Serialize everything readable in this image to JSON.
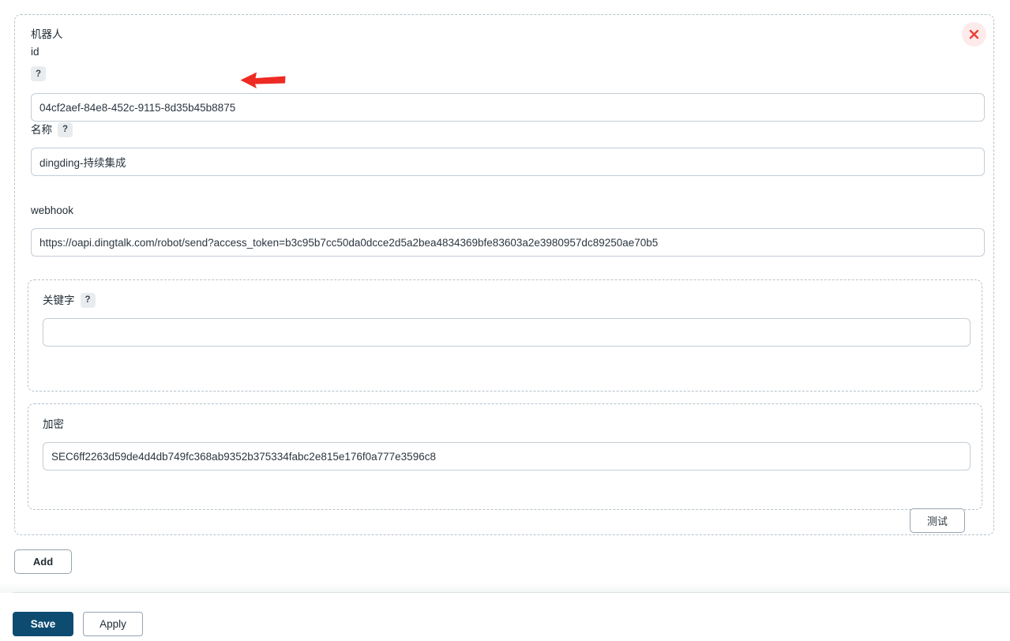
{
  "card": {
    "close_icon": "close-icon",
    "test_button_label": "测试",
    "add_button_label": "Add"
  },
  "fields": {
    "robot_id": {
      "label": "机器人\nid",
      "help": "?",
      "value": "04cf2aef-84e8-452c-9115-8d35b45b8875",
      "placeholder": ""
    },
    "name": {
      "label": "名称",
      "help": "?",
      "value": "dingding-持续集成",
      "placeholder": ""
    },
    "webhook": {
      "label": "webhook",
      "value": "https://oapi.dingtalk.com/robot/send?access_token=b3c95b7cc50da0dcce2d5a2bea4834369bfe83603a2e3980957dc89250ae70b5",
      "placeholder": ""
    },
    "keyword": {
      "label": "关键字",
      "help": "?",
      "value": "",
      "placeholder": ""
    },
    "encrypt": {
      "label": "加密",
      "value": "SEC6ff2263d59de4d4db749fc368ab9352b375334fabc2e815e176f0a777e3596c8",
      "placeholder": ""
    }
  },
  "footer": {
    "save_label": "Save",
    "apply_label": "Apply"
  },
  "annotation": {
    "arrow_icon": "left-arrow-annotation-icon",
    "arrow_color": "#ee2b22"
  },
  "colors": {
    "save_button": "#0d4c70",
    "dashed_border": "#b6c2cb",
    "input_border": "#c3ced6",
    "close_badge_bg": "#fdeaea",
    "close_glyph": "#e8403a"
  }
}
